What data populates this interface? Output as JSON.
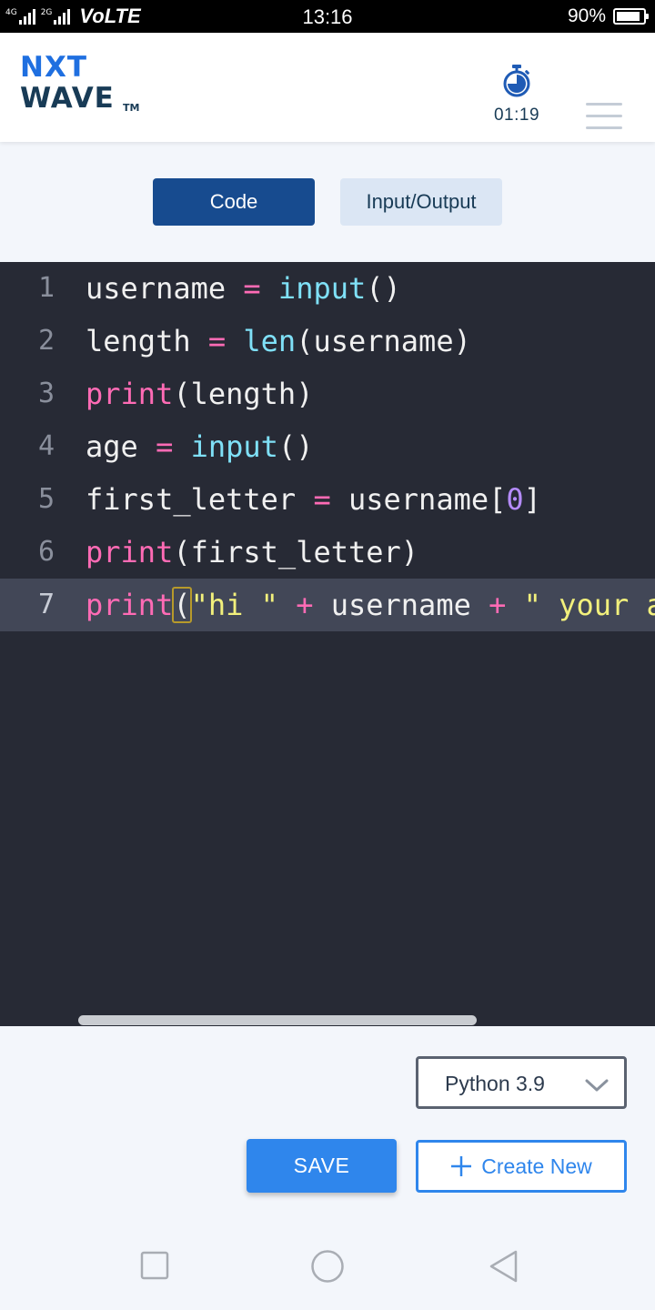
{
  "status_bar": {
    "network_1": "4G",
    "network_2": "2G",
    "volte": "VoLTE",
    "time": "13:16",
    "battery_percent": "90%",
    "battery_level": 0.9
  },
  "header": {
    "logo_line1": "NXT",
    "logo_line2": "WAVE",
    "logo_tm": "TM",
    "timer": "01:19",
    "icons": {
      "timer": "stopwatch-icon",
      "menu": "hamburger-menu-icon"
    }
  },
  "tabs": [
    {
      "label": "Code",
      "active": true
    },
    {
      "label": "Input/Output",
      "active": false
    }
  ],
  "editor": {
    "active_line": 7,
    "lines": [
      {
        "number": "1",
        "tokens": [
          {
            "t": "username",
            "k": "id"
          },
          {
            "t": " ",
            "k": "id"
          },
          {
            "t": "=",
            "k": "op"
          },
          {
            "t": " ",
            "k": "id"
          },
          {
            "t": "input",
            "k": "fn"
          },
          {
            "t": "()",
            "k": "br"
          }
        ]
      },
      {
        "number": "2",
        "tokens": [
          {
            "t": "length",
            "k": "id"
          },
          {
            "t": " ",
            "k": "id"
          },
          {
            "t": "=",
            "k": "op"
          },
          {
            "t": " ",
            "k": "id"
          },
          {
            "t": "len",
            "k": "fn"
          },
          {
            "t": "(username)",
            "k": "br"
          }
        ]
      },
      {
        "number": "3",
        "tokens": [
          {
            "t": "print",
            "k": "kw"
          },
          {
            "t": "(length)",
            "k": "br"
          }
        ]
      },
      {
        "number": "4",
        "tokens": [
          {
            "t": "age",
            "k": "id"
          },
          {
            "t": " ",
            "k": "id"
          },
          {
            "t": "=",
            "k": "op"
          },
          {
            "t": " ",
            "k": "id"
          },
          {
            "t": "input",
            "k": "fn"
          },
          {
            "t": "()",
            "k": "br"
          }
        ]
      },
      {
        "number": "5",
        "tokens": [
          {
            "t": "first_letter",
            "k": "id"
          },
          {
            "t": " ",
            "k": "id"
          },
          {
            "t": "=",
            "k": "op"
          },
          {
            "t": " ",
            "k": "id"
          },
          {
            "t": "username[",
            "k": "id"
          },
          {
            "t": "0",
            "k": "num"
          },
          {
            "t": "]",
            "k": "br"
          }
        ]
      },
      {
        "number": "6",
        "tokens": [
          {
            "t": "print",
            "k": "kw"
          },
          {
            "t": "(first_letter)",
            "k": "br"
          }
        ]
      },
      {
        "number": "7",
        "tokens": [
          {
            "t": "print",
            "k": "kw"
          },
          {
            "t": "(",
            "k": "br",
            "hl": true
          },
          {
            "t": "\"hi \"",
            "k": "str"
          },
          {
            "t": " ",
            "k": "id"
          },
          {
            "t": "+",
            "k": "op"
          },
          {
            "t": " username ",
            "k": "id"
          },
          {
            "t": "+",
            "k": "op"
          },
          {
            "t": " ",
            "k": "id"
          },
          {
            "t": "\" your a",
            "k": "str"
          }
        ]
      }
    ]
  },
  "controls": {
    "language_selected": "Python 3.9",
    "save_label": "SAVE",
    "create_new_label": "Create New"
  },
  "nav": {
    "icons": [
      "recent-apps-icon",
      "home-icon",
      "back-icon"
    ]
  }
}
